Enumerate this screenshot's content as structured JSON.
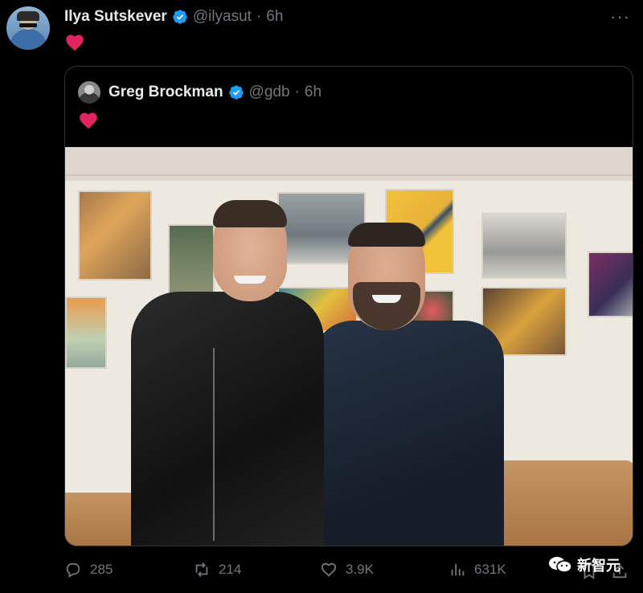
{
  "tweet": {
    "author_name": "Ilya Sutskever",
    "author_handle": "@ilyasut",
    "separator": "·",
    "time": "6h",
    "more_label": "···",
    "content_icon": "heart-icon",
    "accent_heart_color": "#f91880",
    "verified_color": "#1d9bf0"
  },
  "quoted_tweet": {
    "author_name": "Greg Brockman",
    "author_handle": "@gdb",
    "separator": "·",
    "time": "6h",
    "content_icon": "heart-icon"
  },
  "actions": {
    "replies": "285",
    "retweets": "214",
    "likes": "3.9K",
    "views": "631K"
  },
  "watermark": {
    "text": "新智元"
  }
}
